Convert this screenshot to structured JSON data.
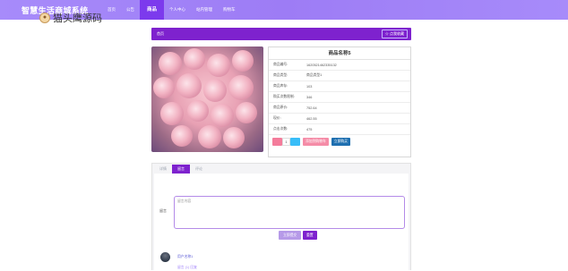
{
  "header": {
    "site_title": "智慧生活商城系统",
    "nav": [
      "首页",
      "公告",
      "商品",
      "个人中心",
      "站内管理",
      "购物车"
    ],
    "active_nav": "商品"
  },
  "watermark": {
    "text": "猫头鹰源码"
  },
  "breadcrumb": {
    "text": "首页",
    "favorite_button": "☆ 点我收藏"
  },
  "product": {
    "name": "商品名称5",
    "fields": [
      {
        "label": "商品编号:",
        "value": "1620521462335132"
      },
      {
        "label": "商品类型:",
        "value": "商品类型1"
      },
      {
        "label": "商品库存:",
        "value": "103"
      },
      {
        "label": "购买次数限制:",
        "value": "346"
      },
      {
        "label": "商品原价:",
        "value": "752.64"
      },
      {
        "label": "现价:",
        "value": "462.55"
      },
      {
        "label": "点击次数:",
        "value": "475"
      }
    ],
    "quantity": "1",
    "add_to_cart": "添加到购物车",
    "buy_now": "立即购买"
  },
  "tabs": [
    "详情",
    "留言",
    "评论"
  ],
  "active_tab": "留言",
  "comment": {
    "label": "留言",
    "placeholder": "留言内容",
    "reset": "立即提交",
    "submit": "重置"
  },
  "user": {
    "name": "用户名称1",
    "reply": "留言 (1) 回复"
  },
  "colors": {
    "accent": "#7e22ce",
    "topbar": "#a78bfa",
    "cart": "#f58ca7",
    "buy": "#1e6fb0"
  }
}
